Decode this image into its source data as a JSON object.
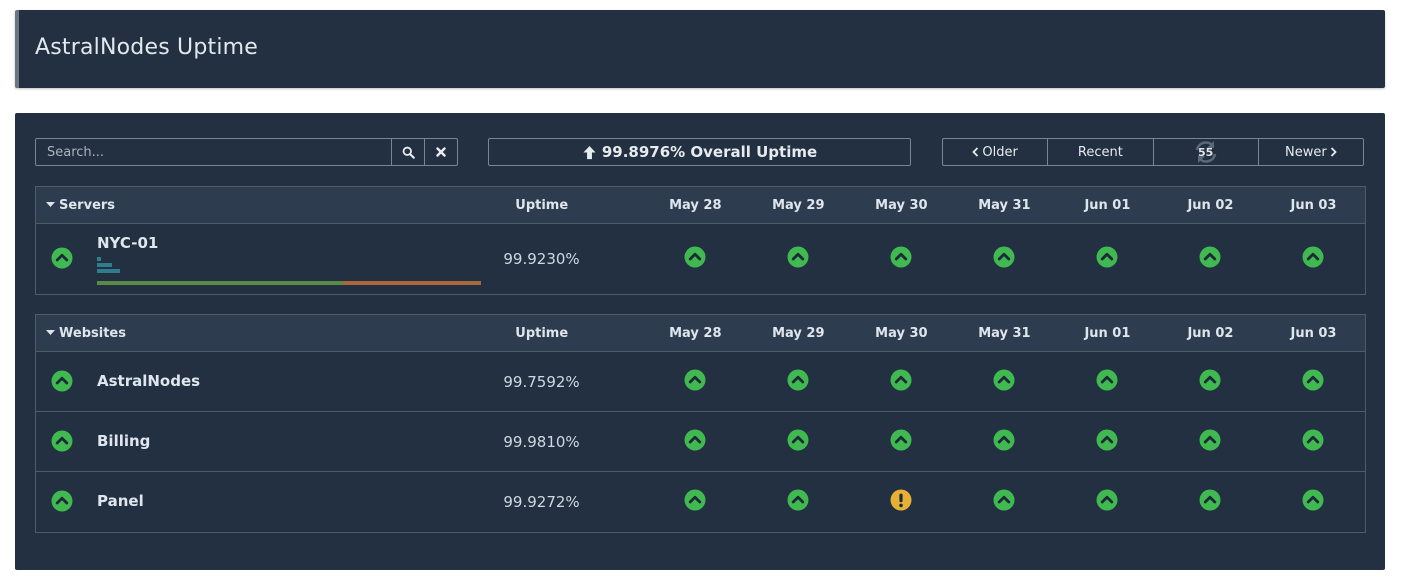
{
  "header": {
    "title": "AstralNodes Uptime"
  },
  "toolbar": {
    "search_placeholder": "Search...",
    "overall_text": "99.8976% Overall Uptime",
    "older_label": "Older",
    "recent_label": "Recent",
    "refresh_count": "55",
    "newer_label": "Newer"
  },
  "columns": {
    "uptime": "Uptime",
    "days": [
      "May 28",
      "May 29",
      "May 30",
      "May 31",
      "Jun 01",
      "Jun 02",
      "Jun 03"
    ]
  },
  "groups": [
    {
      "name": "Servers",
      "rows": [
        {
          "name": "NYC-01",
          "uptime": "99.9230%",
          "status": "up",
          "days": [
            "up",
            "up",
            "up",
            "up",
            "up",
            "up",
            "up"
          ],
          "usage_bars": [
            0.01,
            0.04,
            0.06
          ]
        }
      ]
    },
    {
      "name": "Websites",
      "rows": [
        {
          "name": "AstralNodes",
          "uptime": "99.7592%",
          "status": "up",
          "days": [
            "up",
            "up",
            "up",
            "up",
            "up",
            "up",
            "up"
          ]
        },
        {
          "name": "Billing",
          "uptime": "99.9810%",
          "status": "up",
          "days": [
            "up",
            "up",
            "up",
            "up",
            "up",
            "up",
            "up"
          ]
        },
        {
          "name": "Panel",
          "uptime": "99.9272%",
          "status": "up",
          "days": [
            "up",
            "up",
            "warn",
            "up",
            "up",
            "up",
            "up"
          ]
        }
      ]
    }
  ],
  "colors": {
    "up": "#3fb950",
    "warn": "#e6b034",
    "timeline_green": "#5b8a46",
    "timeline_orange": "#a8683a",
    "usage_bar": "#2f7c8f"
  },
  "icons": {
    "status_up": "chevron-up-circle-icon",
    "status_warn": "exclamation-circle-icon",
    "search": "search-icon",
    "clear": "close-icon",
    "overall": "arrow-up-icon",
    "refresh": "refresh-icon",
    "collapse": "caret-down-icon"
  }
}
